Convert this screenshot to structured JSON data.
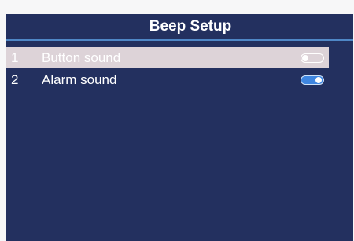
{
  "header": {
    "title": "Beep Setup"
  },
  "menu": {
    "items": [
      {
        "number": "1",
        "label": "Button sound",
        "enabled": false,
        "selected": true
      },
      {
        "number": "2",
        "label": "Alarm sound",
        "enabled": true,
        "selected": false
      }
    ]
  },
  "colors": {
    "background": "#23305f",
    "accent_line": "#4f87c6",
    "selected_row": "#ddd3d8",
    "toggle_on": "#3f86e0"
  }
}
